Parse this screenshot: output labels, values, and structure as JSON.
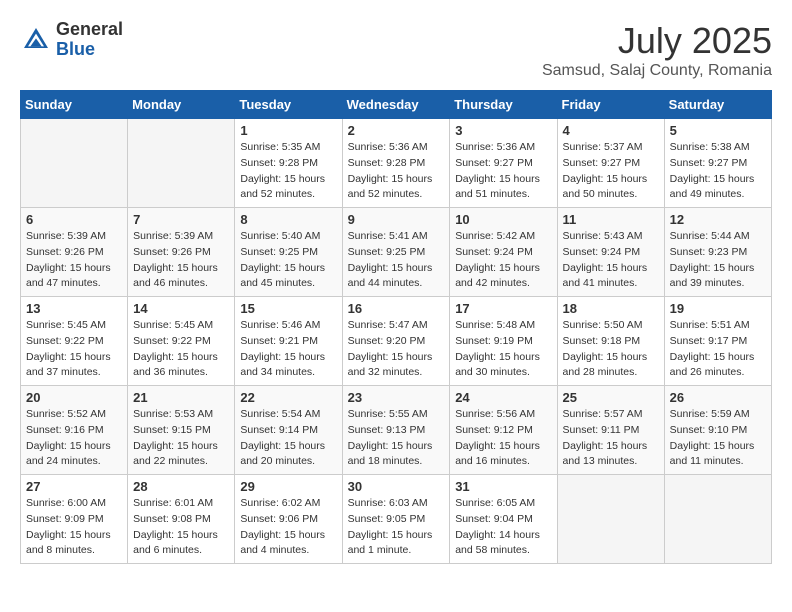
{
  "logo": {
    "general": "General",
    "blue": "Blue"
  },
  "title": "July 2025",
  "location": "Samsud, Salaj County, Romania",
  "days_of_week": [
    "Sunday",
    "Monday",
    "Tuesday",
    "Wednesday",
    "Thursday",
    "Friday",
    "Saturday"
  ],
  "weeks": [
    [
      {
        "day": "",
        "info": ""
      },
      {
        "day": "",
        "info": ""
      },
      {
        "day": "1",
        "info": "Sunrise: 5:35 AM\nSunset: 9:28 PM\nDaylight: 15 hours and 52 minutes."
      },
      {
        "day": "2",
        "info": "Sunrise: 5:36 AM\nSunset: 9:28 PM\nDaylight: 15 hours and 52 minutes."
      },
      {
        "day": "3",
        "info": "Sunrise: 5:36 AM\nSunset: 9:27 PM\nDaylight: 15 hours and 51 minutes."
      },
      {
        "day": "4",
        "info": "Sunrise: 5:37 AM\nSunset: 9:27 PM\nDaylight: 15 hours and 50 minutes."
      },
      {
        "day": "5",
        "info": "Sunrise: 5:38 AM\nSunset: 9:27 PM\nDaylight: 15 hours and 49 minutes."
      }
    ],
    [
      {
        "day": "6",
        "info": "Sunrise: 5:39 AM\nSunset: 9:26 PM\nDaylight: 15 hours and 47 minutes."
      },
      {
        "day": "7",
        "info": "Sunrise: 5:39 AM\nSunset: 9:26 PM\nDaylight: 15 hours and 46 minutes."
      },
      {
        "day": "8",
        "info": "Sunrise: 5:40 AM\nSunset: 9:25 PM\nDaylight: 15 hours and 45 minutes."
      },
      {
        "day": "9",
        "info": "Sunrise: 5:41 AM\nSunset: 9:25 PM\nDaylight: 15 hours and 44 minutes."
      },
      {
        "day": "10",
        "info": "Sunrise: 5:42 AM\nSunset: 9:24 PM\nDaylight: 15 hours and 42 minutes."
      },
      {
        "day": "11",
        "info": "Sunrise: 5:43 AM\nSunset: 9:24 PM\nDaylight: 15 hours and 41 minutes."
      },
      {
        "day": "12",
        "info": "Sunrise: 5:44 AM\nSunset: 9:23 PM\nDaylight: 15 hours and 39 minutes."
      }
    ],
    [
      {
        "day": "13",
        "info": "Sunrise: 5:45 AM\nSunset: 9:22 PM\nDaylight: 15 hours and 37 minutes."
      },
      {
        "day": "14",
        "info": "Sunrise: 5:45 AM\nSunset: 9:22 PM\nDaylight: 15 hours and 36 minutes."
      },
      {
        "day": "15",
        "info": "Sunrise: 5:46 AM\nSunset: 9:21 PM\nDaylight: 15 hours and 34 minutes."
      },
      {
        "day": "16",
        "info": "Sunrise: 5:47 AM\nSunset: 9:20 PM\nDaylight: 15 hours and 32 minutes."
      },
      {
        "day": "17",
        "info": "Sunrise: 5:48 AM\nSunset: 9:19 PM\nDaylight: 15 hours and 30 minutes."
      },
      {
        "day": "18",
        "info": "Sunrise: 5:50 AM\nSunset: 9:18 PM\nDaylight: 15 hours and 28 minutes."
      },
      {
        "day": "19",
        "info": "Sunrise: 5:51 AM\nSunset: 9:17 PM\nDaylight: 15 hours and 26 minutes."
      }
    ],
    [
      {
        "day": "20",
        "info": "Sunrise: 5:52 AM\nSunset: 9:16 PM\nDaylight: 15 hours and 24 minutes."
      },
      {
        "day": "21",
        "info": "Sunrise: 5:53 AM\nSunset: 9:15 PM\nDaylight: 15 hours and 22 minutes."
      },
      {
        "day": "22",
        "info": "Sunrise: 5:54 AM\nSunset: 9:14 PM\nDaylight: 15 hours and 20 minutes."
      },
      {
        "day": "23",
        "info": "Sunrise: 5:55 AM\nSunset: 9:13 PM\nDaylight: 15 hours and 18 minutes."
      },
      {
        "day": "24",
        "info": "Sunrise: 5:56 AM\nSunset: 9:12 PM\nDaylight: 15 hours and 16 minutes."
      },
      {
        "day": "25",
        "info": "Sunrise: 5:57 AM\nSunset: 9:11 PM\nDaylight: 15 hours and 13 minutes."
      },
      {
        "day": "26",
        "info": "Sunrise: 5:59 AM\nSunset: 9:10 PM\nDaylight: 15 hours and 11 minutes."
      }
    ],
    [
      {
        "day": "27",
        "info": "Sunrise: 6:00 AM\nSunset: 9:09 PM\nDaylight: 15 hours and 8 minutes."
      },
      {
        "day": "28",
        "info": "Sunrise: 6:01 AM\nSunset: 9:08 PM\nDaylight: 15 hours and 6 minutes."
      },
      {
        "day": "29",
        "info": "Sunrise: 6:02 AM\nSunset: 9:06 PM\nDaylight: 15 hours and 4 minutes."
      },
      {
        "day": "30",
        "info": "Sunrise: 6:03 AM\nSunset: 9:05 PM\nDaylight: 15 hours and 1 minute."
      },
      {
        "day": "31",
        "info": "Sunrise: 6:05 AM\nSunset: 9:04 PM\nDaylight: 14 hours and 58 minutes."
      },
      {
        "day": "",
        "info": ""
      },
      {
        "day": "",
        "info": ""
      }
    ]
  ]
}
